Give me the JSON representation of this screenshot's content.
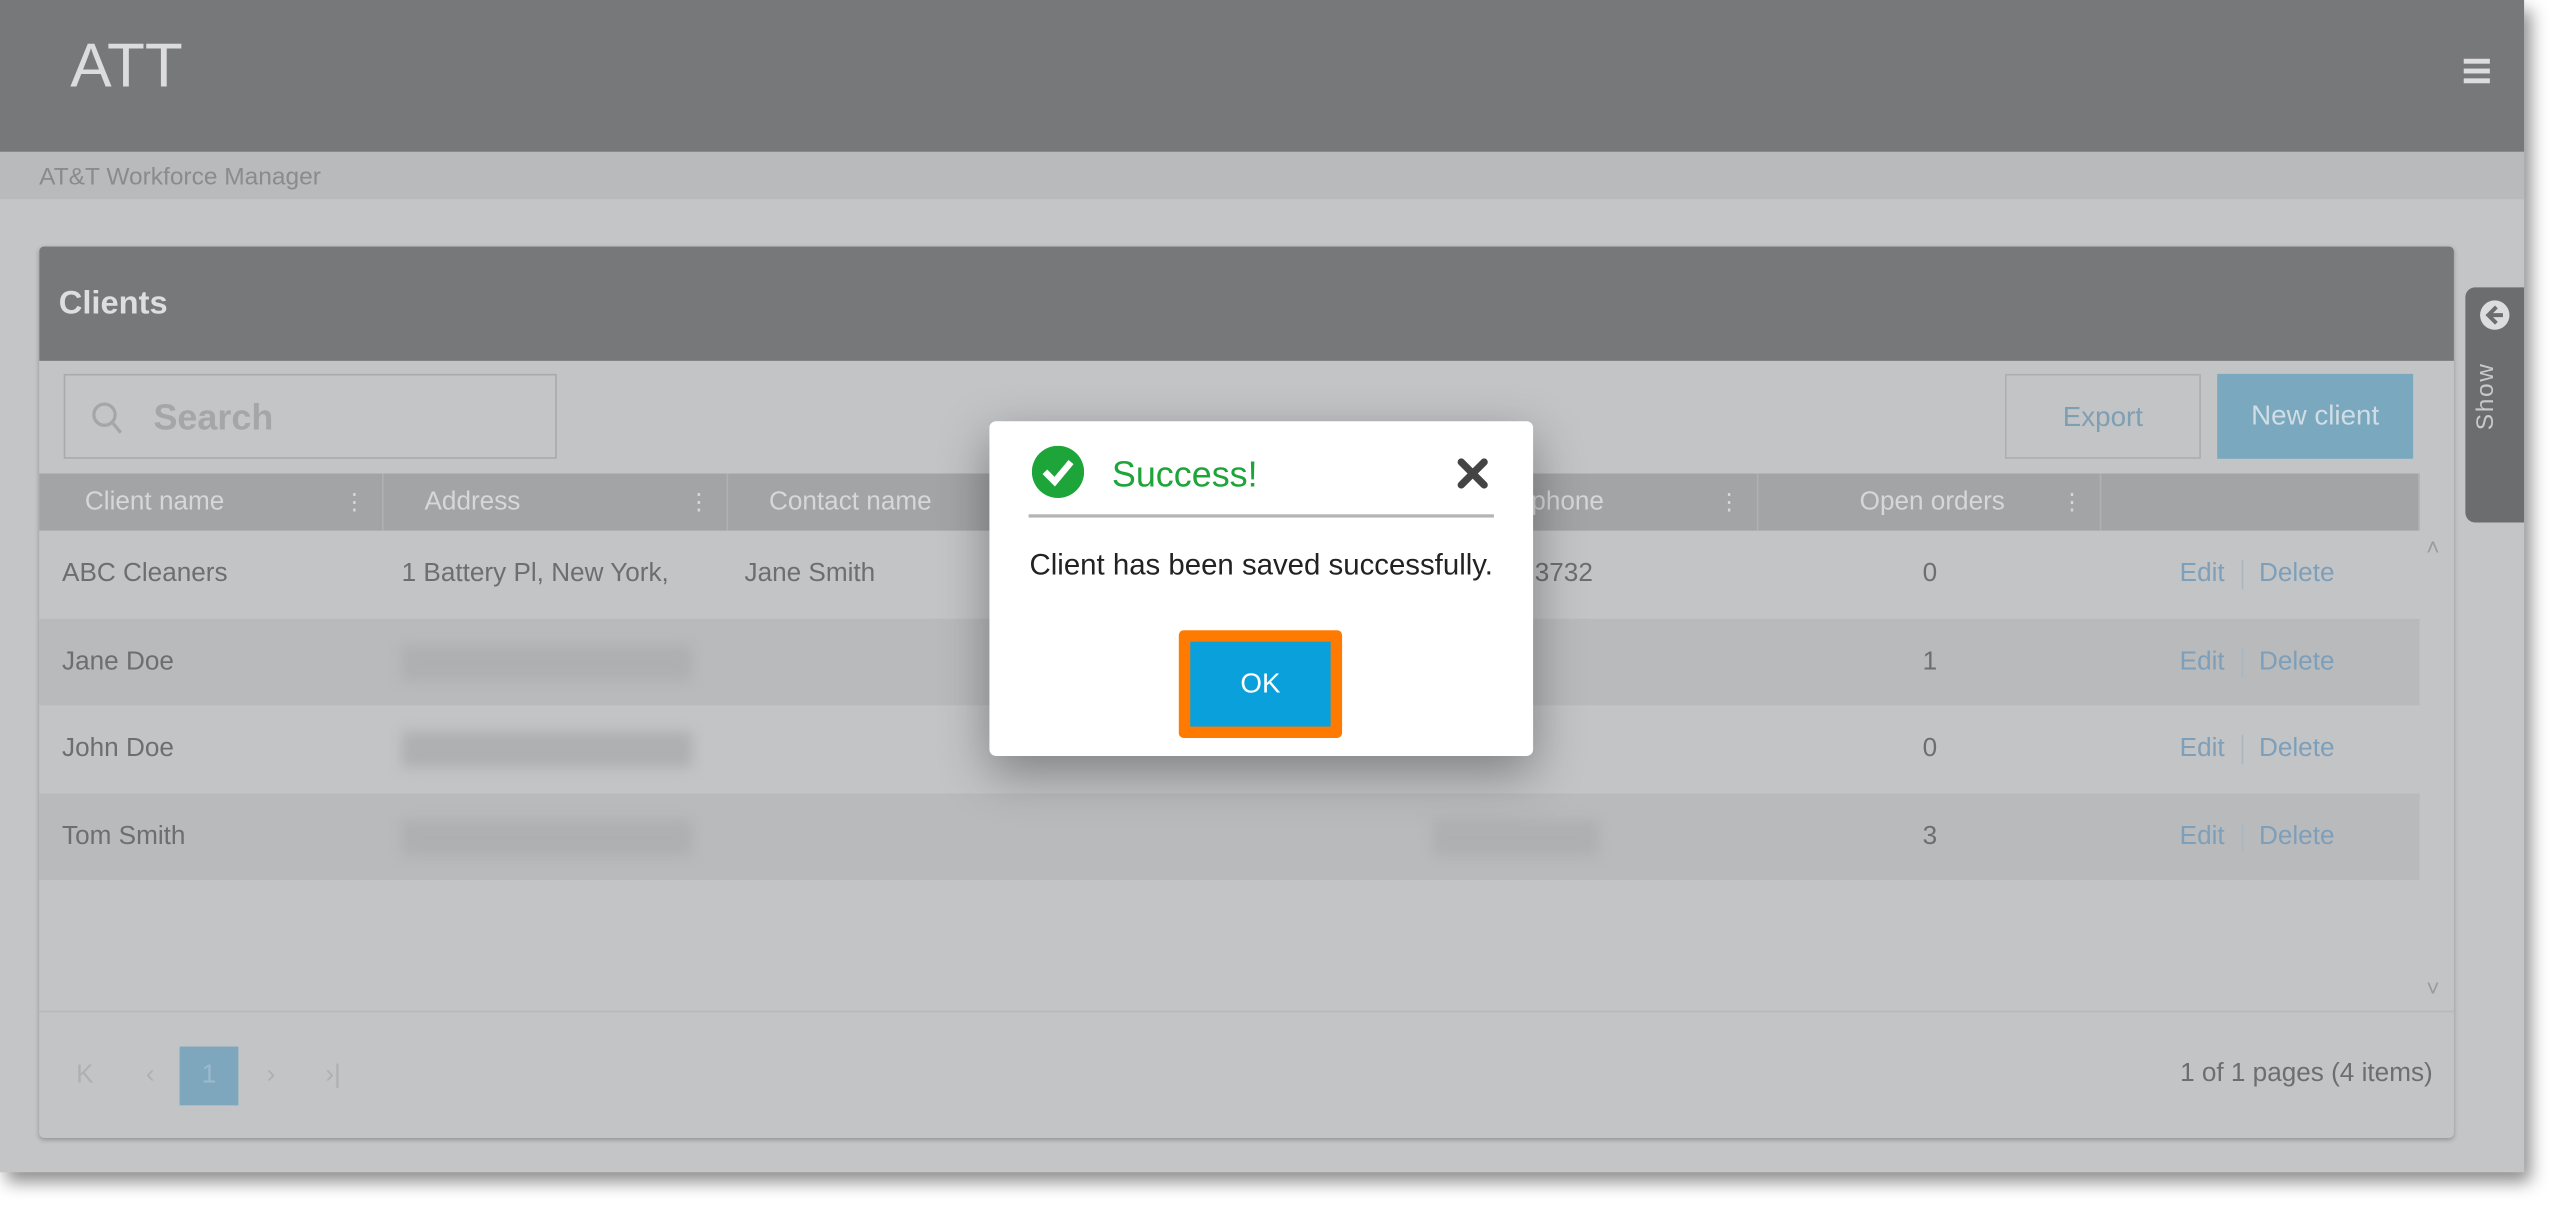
{
  "app": {
    "brand": "ATT",
    "subtitle": "AT&T Workforce Manager",
    "menu_icon": "hamburger-icon"
  },
  "panel": {
    "title": "Clients",
    "search_placeholder": "Search",
    "export_label": "Export",
    "new_client_label": "New client"
  },
  "table": {
    "columns": [
      "Client name",
      "Address",
      "Contact name",
      "",
      "t phone",
      "Open orders",
      ""
    ],
    "rows": [
      {
        "client": "ABC Cleaners",
        "address": "1 Battery Pl, New York,",
        "contact": "Jane Smith",
        "phone": "3732",
        "orders": "0"
      },
      {
        "client": "Jane Doe",
        "address": "",
        "contact": "",
        "phone": "",
        "orders": "1"
      },
      {
        "client": "John Doe",
        "address": "",
        "contact": "",
        "phone": "",
        "orders": "0"
      },
      {
        "client": "Tom Smith",
        "address": "",
        "contact": "",
        "phone": "",
        "orders": "3"
      }
    ],
    "edit_label": "Edit",
    "delete_label": "Delete"
  },
  "pager": {
    "current": "1",
    "info": "1 of 1 pages (4 items)"
  },
  "side_tab": {
    "label": "Show"
  },
  "modal": {
    "title": "Success!",
    "message": "Client has been saved successfully.",
    "ok_label": "OK",
    "title_color": "#1ea53a",
    "ok_color": "#0aa0dc",
    "highlight_color": "#ff7a00"
  }
}
